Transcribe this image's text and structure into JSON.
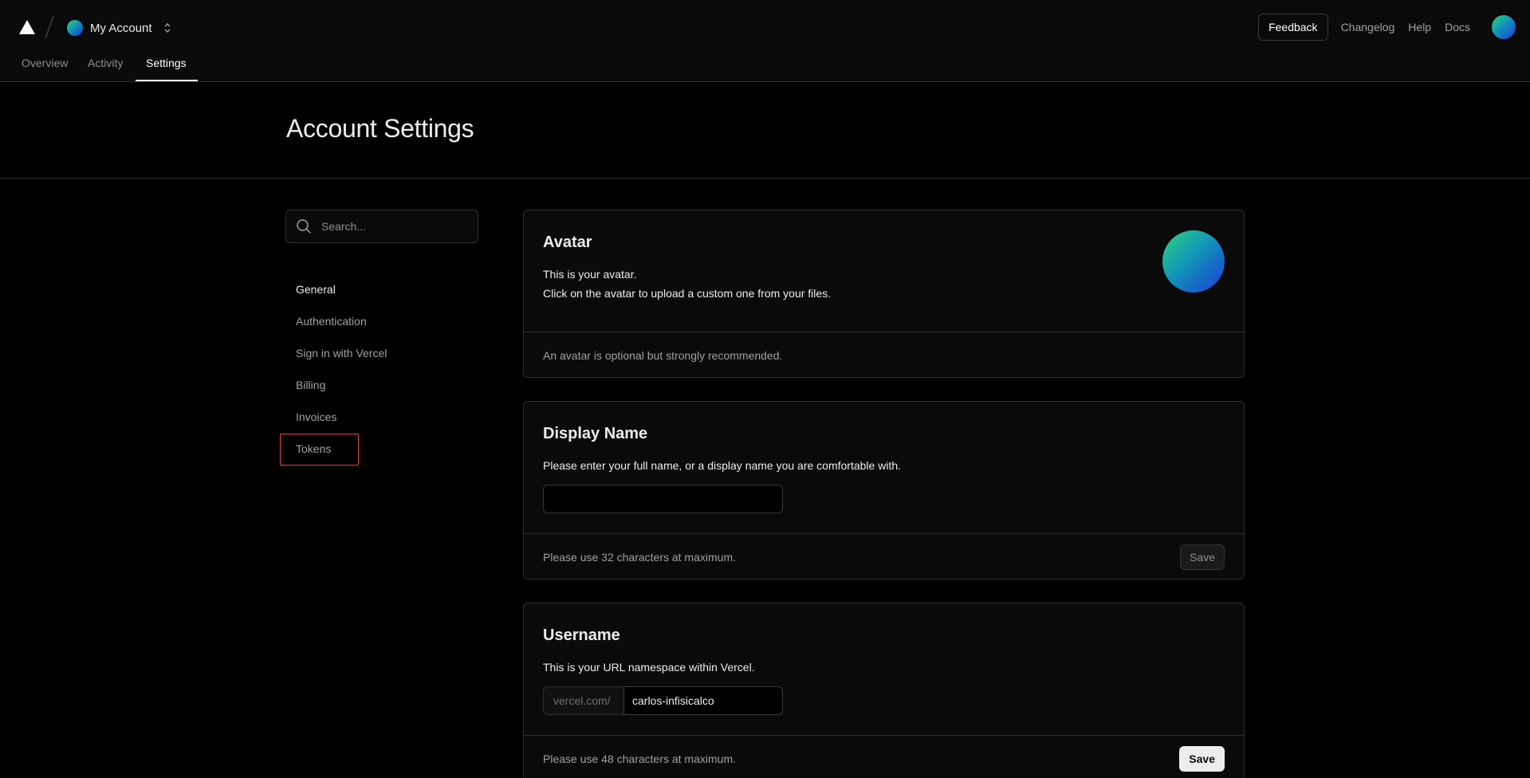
{
  "header": {
    "account_name": "My Account",
    "feedback_label": "Feedback",
    "links": [
      "Changelog",
      "Help",
      "Docs"
    ]
  },
  "tabs": [
    {
      "label": "Overview",
      "active": false
    },
    {
      "label": "Activity",
      "active": false
    },
    {
      "label": "Settings",
      "active": true
    }
  ],
  "page": {
    "title": "Account Settings"
  },
  "sidebar": {
    "search_placeholder": "Search...",
    "items": [
      "General",
      "Authentication",
      "Sign in with Vercel",
      "Billing",
      "Invoices",
      "Tokens"
    ],
    "active_index": 0,
    "highlighted_index": 5
  },
  "cards": {
    "avatar": {
      "title": "Avatar",
      "line1": "This is your avatar.",
      "line2": "Click on the avatar to upload a custom one from your files.",
      "footer": "An avatar is optional but strongly recommended."
    },
    "display_name": {
      "title": "Display Name",
      "description": "Please enter your full name, or a display name you are comfortable with.",
      "value": "",
      "footer": "Please use 32 characters at maximum.",
      "save_label": "Save"
    },
    "username": {
      "title": "Username",
      "description": "This is your URL namespace within Vercel.",
      "prefix": "vercel.com/",
      "value": "carlos-infisicalco",
      "footer": "Please use 48 characters at maximum.",
      "save_label": "Save"
    }
  },
  "colors": {
    "background": "#000000",
    "surface": "#0a0a0a",
    "border": "#2e2e2e",
    "highlight": "#e5484d"
  }
}
